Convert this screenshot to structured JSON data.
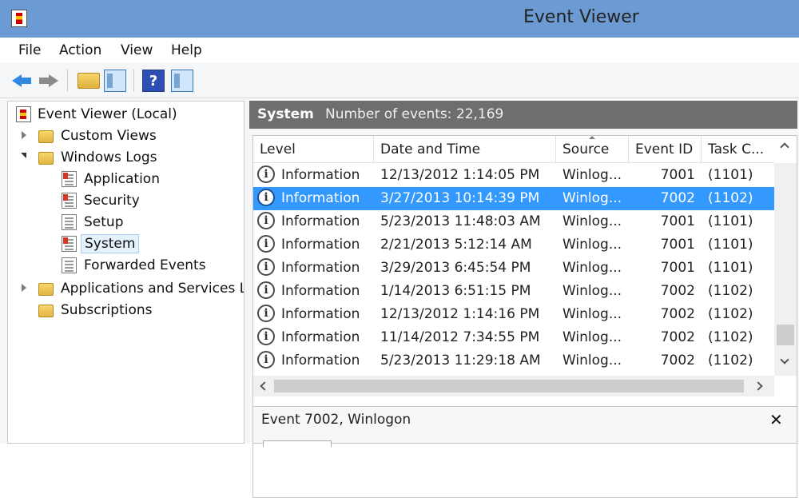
{
  "window": {
    "title": "Event Viewer"
  },
  "menu": [
    "File",
    "Action",
    "View",
    "Help"
  ],
  "toolbar": {
    "buttons": [
      {
        "icon": "back-arrow-icon"
      },
      {
        "icon": "forward-arrow-icon"
      },
      {
        "icon": "open-folder-icon"
      },
      {
        "icon": "show-hide-console-tree-icon"
      },
      {
        "icon": "help-icon",
        "glyph": "?"
      },
      {
        "icon": "show-hide-action-pane-icon"
      }
    ]
  },
  "tree": {
    "root": "Event Viewer (Local)",
    "custom_views": "Custom Views",
    "windows_logs": "Windows Logs",
    "logs": [
      "Application",
      "Security",
      "Setup",
      "System",
      "Forwarded Events"
    ],
    "apps_services": "Applications and Services Lo",
    "subscriptions": "Subscriptions",
    "selected": "System"
  },
  "pane_header": {
    "title": "System",
    "count": "Number of events: 22,169"
  },
  "grid": {
    "columns": [
      "Level",
      "Date and Time",
      "Source",
      "Event ID",
      "Task C..."
    ],
    "rows": [
      {
        "level": "Information",
        "datetime": "12/13/2012 1:14:05 PM",
        "source": "Winlog...",
        "event_id": "7001",
        "task": "(1101)"
      },
      {
        "level": "Information",
        "datetime": "3/27/2013 10:14:39 PM",
        "source": "Winlog...",
        "event_id": "7002",
        "task": "(1102)",
        "selected": true
      },
      {
        "level": "Information",
        "datetime": "5/23/2013 11:48:03 AM",
        "source": "Winlog...",
        "event_id": "7001",
        "task": "(1101)"
      },
      {
        "level": "Information",
        "datetime": "2/21/2013 5:12:14 AM",
        "source": "Winlog...",
        "event_id": "7001",
        "task": "(1101)"
      },
      {
        "level": "Information",
        "datetime": "3/29/2013 6:45:54 PM",
        "source": "Winlog...",
        "event_id": "7001",
        "task": "(1101)"
      },
      {
        "level": "Information",
        "datetime": "1/14/2013 6:51:15 PM",
        "source": "Winlog...",
        "event_id": "7002",
        "task": "(1102)"
      },
      {
        "level": "Information",
        "datetime": "12/13/2012 1:14:16 PM",
        "source": "Winlog...",
        "event_id": "7002",
        "task": "(1102)"
      },
      {
        "level": "Information",
        "datetime": "11/14/2012 7:34:55 PM",
        "source": "Winlog...",
        "event_id": "7002",
        "task": "(1102)"
      },
      {
        "level": "Information",
        "datetime": "5/23/2013 11:29:18 AM",
        "source": "Winlog...",
        "event_id": "7002",
        "task": "(1102)"
      }
    ]
  },
  "detail": {
    "title": "Event 7002, Winlogon",
    "close_glyph": "✕"
  },
  "colors": {
    "title_bar": "#6b9bd2",
    "selection": "#3399ff",
    "pane_header": "#6e6e6e"
  }
}
